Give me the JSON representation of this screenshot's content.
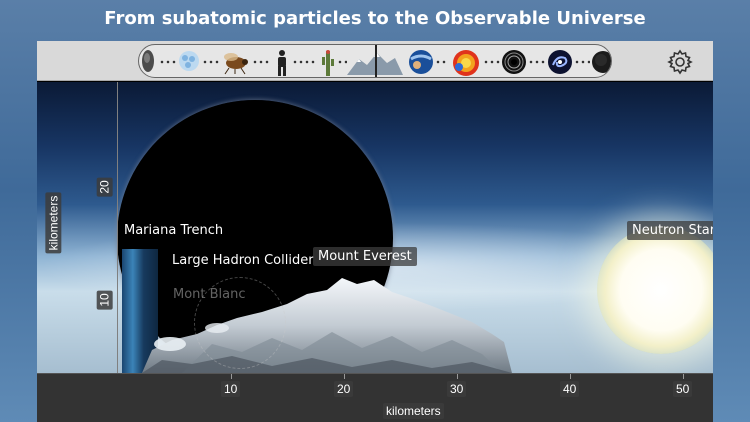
{
  "headline": "From subatomic particles to the Observable Universe",
  "toolbar": {
    "strip_items": [
      "neutron-icon",
      "molecule-icon",
      "insect-icon",
      "person-icon",
      "cactus-icon",
      "mountain-icon",
      "planet-icon",
      "sun-icon",
      "black-hole-icon",
      "galaxy-icon",
      "universe-icon"
    ],
    "settings_icon": "gear-icon"
  },
  "scene": {
    "labels": {
      "mariana_trench": "Mariana Trench",
      "large_hadron_collider": "Large Hadron Collider",
      "mount_everest": "Mount Everest",
      "mont_blanc": "Mont Blanc",
      "neutron_star": "Neutron Star"
    },
    "y_axis": {
      "title": "kilometers",
      "ticks": [
        "20",
        "10"
      ]
    },
    "x_axis": {
      "title": "kilometers",
      "ticks": [
        "10",
        "20",
        "30",
        "40",
        "50"
      ]
    }
  },
  "colors": {
    "toolbar_bg": "#d9d9d9",
    "axis_bg": "#333333",
    "label_bg": "#3c3c3c",
    "page_bg": "#4a75a2"
  }
}
